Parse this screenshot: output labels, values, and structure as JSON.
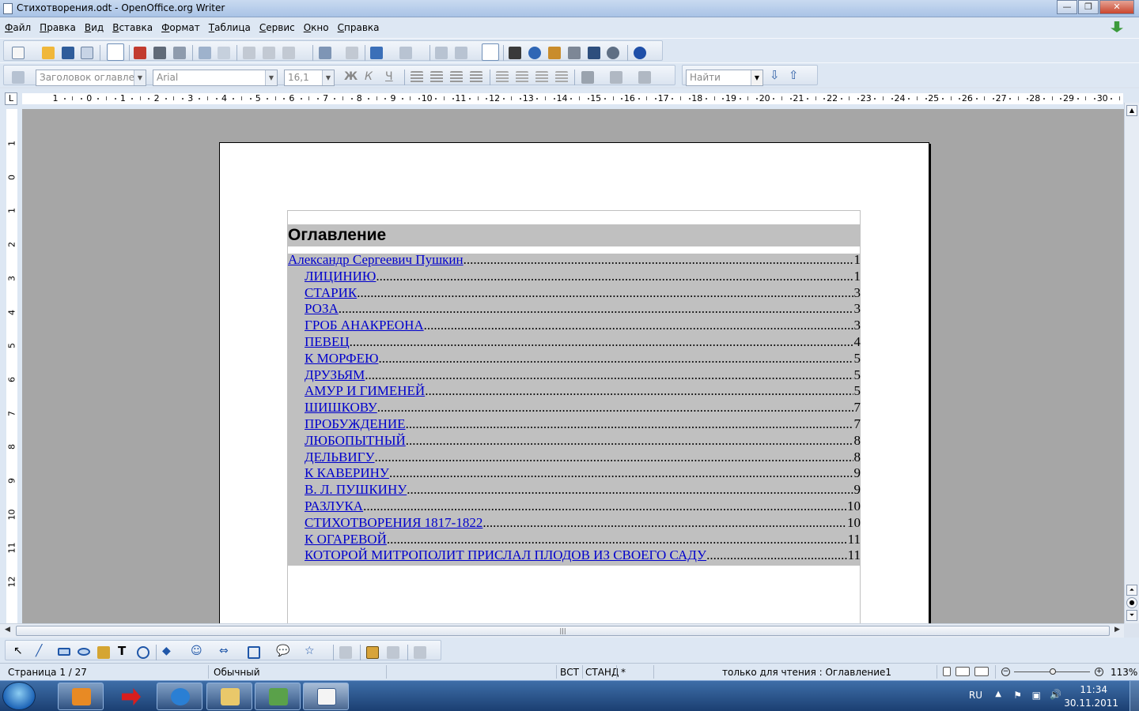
{
  "window": {
    "title": "Стихотворения.odt - OpenOffice.org Writer",
    "minimize": "—",
    "maximize": "❐",
    "close": "✕"
  },
  "menu": [
    "Файл",
    "Правка",
    "Вид",
    "Вставка",
    "Формат",
    "Таблица",
    "Сервис",
    "Окно",
    "Справка"
  ],
  "formatting": {
    "paragraph_style": "Заголовок оглавлени",
    "font_name": "Arial",
    "font_size": "16,1",
    "bold_glyph": "Ж",
    "italic_glyph": "К",
    "underline_glyph": "Ч",
    "find_placeholder": "Найти"
  },
  "ruler": {
    "marks": [
      "1",
      "0",
      "1",
      "2",
      "3",
      "4",
      "5",
      "6",
      "7",
      "8",
      "9",
      "10",
      "11",
      "12",
      "13",
      "14",
      "15",
      "16",
      "17",
      "18",
      "19",
      "20",
      "21",
      "22",
      "23",
      "24",
      "25",
      "26",
      "27",
      "28",
      "29",
      "30"
    ],
    "vertical_marks": [
      "1",
      "0",
      "1",
      "2",
      "3",
      "4",
      "5",
      "6",
      "7",
      "8",
      "9",
      "10",
      "11",
      "12"
    ],
    "tab_glyph": "L"
  },
  "document": {
    "toc_title": "Оглавление",
    "toc": [
      {
        "label": "Александр Сергеевич Пушкин",
        "page": "1",
        "level": 1
      },
      {
        "label": "ЛИЦИНИЮ",
        "page": "1",
        "level": 2
      },
      {
        "label": "СТАРИК",
        "page": "3",
        "level": 2
      },
      {
        "label": "РОЗА",
        "page": "3",
        "level": 2
      },
      {
        "label": "ГРОБ АНАКРЕОНА",
        "page": "3",
        "level": 2
      },
      {
        "label": "ПЕВЕЦ",
        "page": "4",
        "level": 2
      },
      {
        "label": "К МОРФЕЮ",
        "page": "5",
        "level": 2
      },
      {
        "label": "ДРУЗЬЯМ",
        "page": "5",
        "level": 2
      },
      {
        "label": "АМУР И ГИМЕНЕЙ",
        "page": "5",
        "level": 2
      },
      {
        "label": "ШИШКОВУ",
        "page": "7",
        "level": 2
      },
      {
        "label": "ПРОБУЖДЕНИЕ",
        "page": "7",
        "level": 2
      },
      {
        "label": "ЛЮБОПЫТНЫЙ",
        "page": "8",
        "level": 2
      },
      {
        "label": "ДЕЛЬВИГУ",
        "page": "8",
        "level": 2
      },
      {
        "label": "К КАВЕРИНУ",
        "page": "9",
        "level": 2
      },
      {
        "label": "В. Л. ПУШКИНУ",
        "page": "9",
        "level": 2
      },
      {
        "label": "РАЗЛУКА",
        "page": "10",
        "level": 2
      },
      {
        "label": "СТИХОТВОРЕНИЯ 1817-1822",
        "page": "10",
        "level": 2
      },
      {
        "label": "К ОГАРЕВОЙ",
        "page": "11",
        "level": 2
      },
      {
        "label": "КОТОРОЙ МИТРОПОЛИТ ПРИСЛАЛ ПЛОДОВ ИЗ СВОЕГО САДУ",
        "page": "11",
        "level": 2
      }
    ]
  },
  "status": {
    "page": "Страница 1 / 27",
    "style": "Обычный",
    "insert_mode": "ВСТ",
    "selection_mode": "СТАНД",
    "modified": "*",
    "info": "только для чтения : Оглавление1",
    "zoom": "113%"
  },
  "taskbar": {
    "language": "RU",
    "time": "11:34",
    "date": "30.11.2011"
  },
  "colors": {
    "link": "#0000cc",
    "toc_shading": "#c0c0c0",
    "doc_background": "#a6a6a6",
    "chrome": "#dde7f3"
  }
}
